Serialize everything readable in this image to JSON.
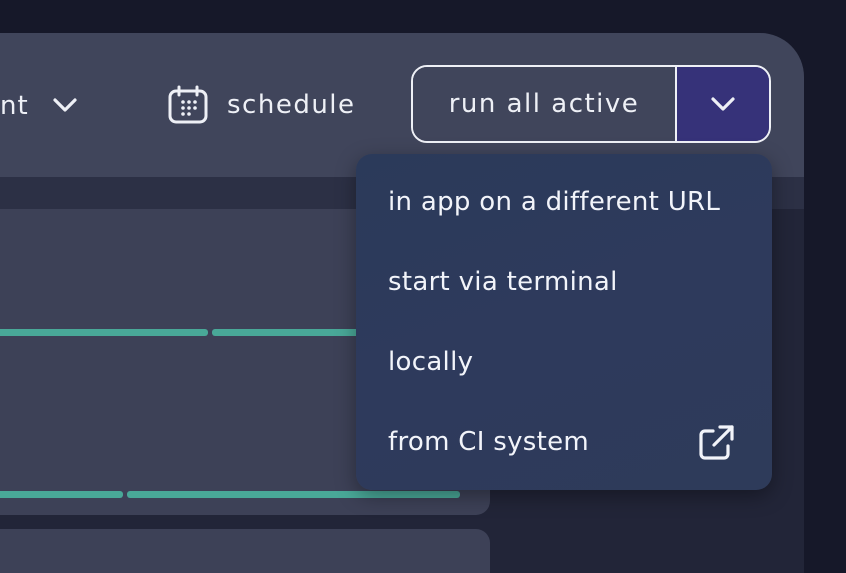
{
  "header": {
    "environment_label_partial": "nt",
    "schedule_label": "schedule",
    "run_button_label": "run all active"
  },
  "dropdown": {
    "items": [
      {
        "label": "in app on a different URL",
        "icon": null
      },
      {
        "label": "start via terminal",
        "icon": null
      },
      {
        "label": "locally",
        "icon": null
      },
      {
        "label": "from CI system",
        "icon": "external-link-icon"
      }
    ]
  },
  "icons": {
    "environment_chevron": "chevron-down-icon",
    "schedule": "calendar-icon",
    "split_toggle": "chevron-down-icon"
  },
  "colors": {
    "background": "#161829",
    "panel": "#222538",
    "header": "#40455b",
    "accent_purple": "#363279",
    "progress_green": "#49a898",
    "dropdown_bg": "#2e3a5c",
    "text": "#eef0f6"
  },
  "progress": {
    "row1_fraction": 1.0,
    "row2_fraction": 1.0
  }
}
